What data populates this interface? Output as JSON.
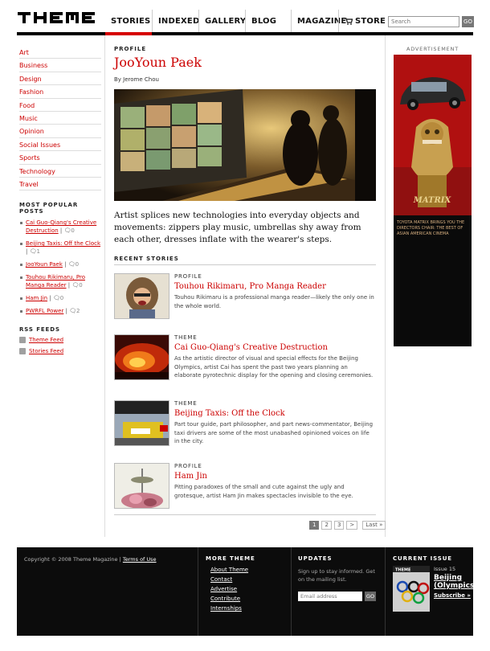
{
  "header": {
    "logo_text": "THEME",
    "nav": [
      "STORIES",
      "INDEXED",
      "GALLERY",
      "BLOG",
      "MAGAZINE",
      "STORE"
    ],
    "search_placeholder": "Search",
    "search_button": "GO"
  },
  "categories": [
    "Art",
    "Business",
    "Design",
    "Fashion",
    "Food",
    "Music",
    "Opinion",
    "Social Issues",
    "Sports",
    "Technology",
    "Travel"
  ],
  "most_popular": {
    "heading": "MOST POPULAR POSTS",
    "items": [
      {
        "title": "Cai Guo-Qiang's Creative Destruction",
        "comments": "0"
      },
      {
        "title": "Beijing Taxis: Off the Clock",
        "comments": "1"
      },
      {
        "title": "JooYoun Paek",
        "comments": "0"
      },
      {
        "title": "Touhou Rikimaru, Pro Manga Reader",
        "comments": "0"
      },
      {
        "title": "Ham Jin",
        "comments": "0"
      },
      {
        "title": "PWRFL Power",
        "comments": "2"
      }
    ]
  },
  "rss": {
    "heading": "RSS FEEDS",
    "items": [
      "Theme Feed",
      "Stories Feed"
    ]
  },
  "article": {
    "section": "PROFILE",
    "title": "JooYoun Paek",
    "byline": "By Jerome Chou",
    "dek": "Artist splices new technologies into everyday objects and movements: zippers play music, umbrellas shy away from each other, dresses inflate with the wearer's steps."
  },
  "recent": {
    "heading": "RECENT STORIES",
    "stories": [
      {
        "kicker": "PROFILE",
        "title": "Touhou Rikimaru, Pro Manga Reader",
        "desc": "Touhou Rikimaru is a professional manga reader—likely the only one in the whole world."
      },
      {
        "kicker": "THEME",
        "title": "Cai Guo-Qiang's Creative Destruction",
        "desc": "As the artistic director of visual and special effects for the Beijing Olympics, artist Cai has spent the past two years planning an elaborate pyrotechnic display for the opening and closing ceremonies."
      },
      {
        "kicker": "THEME",
        "title": "Beijing Taxis: Off the Clock",
        "desc": "Part tour guide, part philosopher, and part news-commentator, Beijing taxi drivers are some of the most unabashed opinioned voices on life in the city."
      },
      {
        "kicker": "PROFILE",
        "title": "Ham Jin",
        "desc": "Pitting paradoxes of the small and cute against the ugly and grotesque, artist Ham Jin makes spectacles invisible to the eye."
      }
    ]
  },
  "pager": {
    "pages": [
      "1",
      "2",
      "3"
    ],
    "next": ">",
    "last": "Last »"
  },
  "advertisement": {
    "label": "ADVERTISEMENT",
    "brand": "MATRIX",
    "tagline": "TOYOTA MATRIX BRINGS YOU THE DIRECTORS CHAIR: THE BEST OF ASIAN AMERICAN CINEMA"
  },
  "footer": {
    "copyright": "Copyright © 2008 Theme Magazine |",
    "terms": "Terms of Use",
    "more_heading": "MORE THEME",
    "more_links": [
      "About Theme",
      "Contact",
      "Advertise",
      "Contribute",
      "Internships"
    ],
    "updates_heading": "UPDATES",
    "updates_text": "Sign up to stay informed. Get on the mailing list.",
    "email_placeholder": "Email address",
    "email_button": "GO",
    "issue_heading": "CURRENT ISSUE",
    "issue_number": "Issue 15",
    "issue_title": "Beijing (Olympics)",
    "subscribe": "Subscribe »"
  },
  "colors": {
    "accent": "#cc0000",
    "nav_bar": "#000000",
    "footer_bg": "#0c0c0c"
  }
}
